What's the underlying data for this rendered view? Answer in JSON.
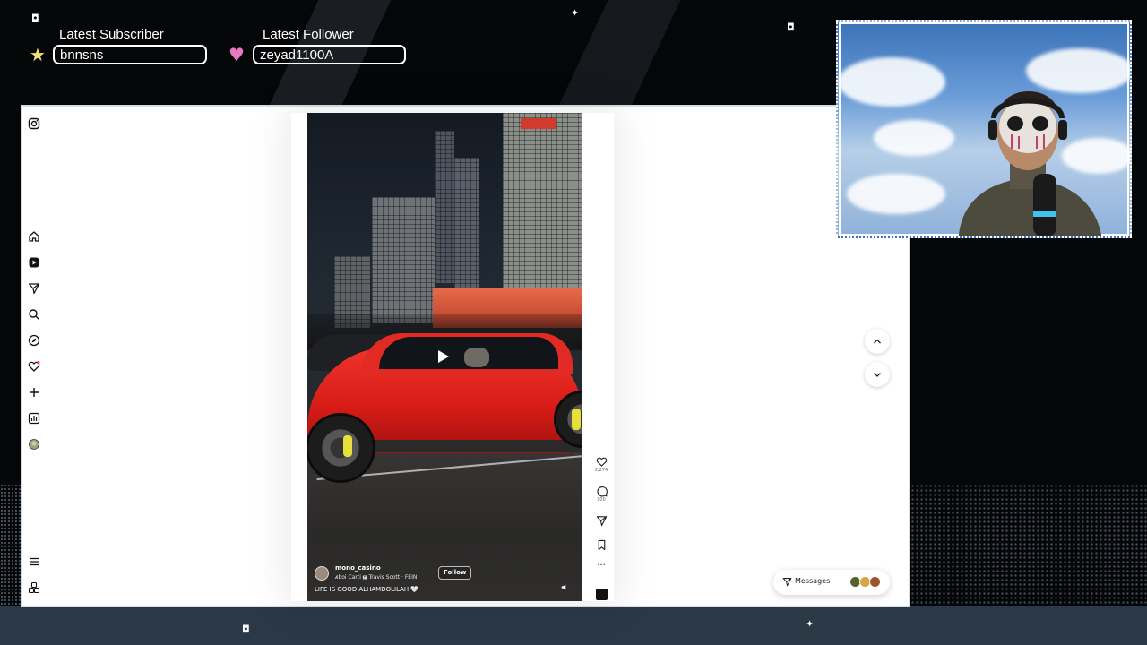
{
  "overlay": {
    "latest_subscriber": {
      "title": "Latest Subscriber",
      "value": "bnnsns",
      "icon": "star-icon",
      "color": "#f3e07a"
    },
    "latest_follower": {
      "title": "Latest Follower",
      "value": "zeyad1100A",
      "icon": "heart-icon",
      "color": "#e87ac4"
    }
  },
  "sidebar": {
    "items": [
      {
        "name": "instagram-logo-icon"
      },
      {
        "name": "home-icon",
        "label": "Home"
      },
      {
        "name": "reels-icon",
        "label": "Reels"
      },
      {
        "name": "messages-icon",
        "label": "Messages"
      },
      {
        "name": "search-icon",
        "label": "Search"
      },
      {
        "name": "explore-icon",
        "label": "Explore"
      },
      {
        "name": "notifications-icon",
        "label": "Notifications"
      },
      {
        "name": "create-icon",
        "label": "Create"
      },
      {
        "name": "dashboard-icon",
        "label": "Dashboard"
      },
      {
        "name": "profile-icon",
        "label": "Profile"
      },
      {
        "name": "more-icon",
        "label": "More"
      },
      {
        "name": "also-from-meta-icon",
        "label": "Also from Meta"
      }
    ]
  },
  "reel": {
    "username": "mono_casino",
    "audio": "𝒽boi Carti 🅴  Travis Scott · FEIN",
    "follow_label": "Follow",
    "caption": "LIFE IS GOOD ALHAMDOLILAH 🤍",
    "likes": "2,274",
    "comments": "100"
  },
  "messages_button": {
    "label": "Messages"
  },
  "colors": {
    "car_red": "#e4201e",
    "browser_bg": "#ffffff",
    "bottom_band": "#2b3846"
  }
}
